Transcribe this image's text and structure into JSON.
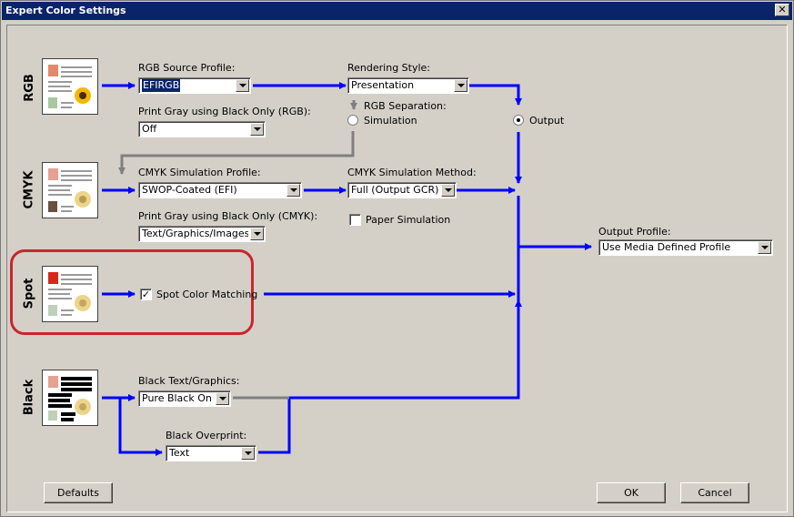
{
  "window": {
    "title": "Expert Color Settings",
    "close_glyph": "✕"
  },
  "rows": {
    "rgb": "RGB",
    "cmyk": "CMYK",
    "spot": "Spot",
    "black": "Black"
  },
  "rgb_source": {
    "label": "RGB Source Profile:",
    "value": "EFIRGB"
  },
  "rgb_gray": {
    "label": "Print Gray using Black Only (RGB):",
    "value": "Off"
  },
  "rendering": {
    "label": "Rendering Style:",
    "value": "Presentation"
  },
  "rgb_separation": {
    "label": "RGB Separation:",
    "simulation_label": "Simulation",
    "output_label": "Output",
    "selected": "Output"
  },
  "cmyk_profile": {
    "label": "CMYK Simulation Profile:",
    "value": "SWOP-Coated (EFI)"
  },
  "cmyk_gray": {
    "label": "Print Gray using Black Only (CMYK):",
    "value": "Text/Graphics/Images"
  },
  "cmyk_method": {
    "label": "CMYK Simulation Method:",
    "value": "Full (Output GCR)"
  },
  "paper_sim": {
    "label": "Paper Simulation",
    "checked": false
  },
  "spot": {
    "label": "Spot Color Matching",
    "checked": true,
    "check_glyph": "✓"
  },
  "black_text": {
    "label": "Black Text/Graphics:",
    "value": "Pure Black On"
  },
  "black_overprint": {
    "label": "Black Overprint:",
    "value": "Text"
  },
  "output_profile": {
    "label": "Output Profile:",
    "value": "Use Media Defined Profile"
  },
  "buttons": {
    "defaults": "Defaults",
    "ok": "OK",
    "cancel": "Cancel"
  },
  "colors": {
    "flow_active": "#0000ff",
    "flow_inactive": "#808080",
    "highlight": "#c8262c"
  }
}
